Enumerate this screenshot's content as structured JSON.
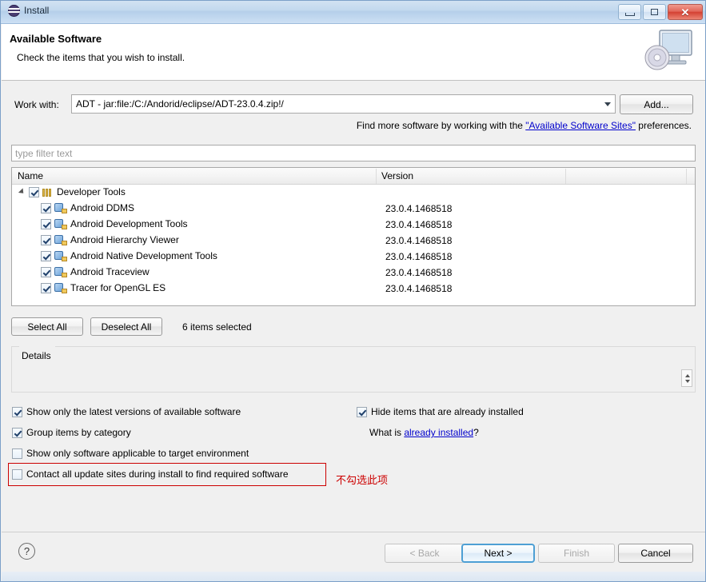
{
  "window": {
    "title": "Install",
    "icon": "eclipse-icon",
    "buttons": {
      "minimize": "minimize-icon",
      "maximize": "maximize-icon",
      "close": "✕"
    }
  },
  "banner": {
    "title": "Available Software",
    "subtitle": "Check the items that you wish to install.",
    "icon": "monitor-disc-icon"
  },
  "work_with": {
    "label": "Work with:",
    "value": "ADT - jar:file:/C:/Andorid/eclipse/ADT-23.0.4.zip!/",
    "add_button": "Add..."
  },
  "find_more": {
    "prefix": "Find more software by working with the ",
    "link": "\"Available Software Sites\"",
    "suffix": " preferences."
  },
  "filter": {
    "placeholder": "type filter text",
    "value": ""
  },
  "table": {
    "columns": [
      "Name",
      "Version",
      ""
    ],
    "rows": [
      {
        "name": "Developer Tools",
        "version": "",
        "checked": true,
        "level": 0,
        "icon": "category-icon",
        "expanded": true
      },
      {
        "name": "Android DDMS",
        "version": "23.0.4.1468518",
        "checked": true,
        "level": 1,
        "icon": "feature-icon"
      },
      {
        "name": "Android Development Tools",
        "version": "23.0.4.1468518",
        "checked": true,
        "level": 1,
        "icon": "feature-icon"
      },
      {
        "name": "Android Hierarchy Viewer",
        "version": "23.0.4.1468518",
        "checked": true,
        "level": 1,
        "icon": "feature-icon"
      },
      {
        "name": "Android Native Development Tools",
        "version": "23.0.4.1468518",
        "checked": true,
        "level": 1,
        "icon": "feature-icon"
      },
      {
        "name": "Android Traceview",
        "version": "23.0.4.1468518",
        "checked": true,
        "level": 1,
        "icon": "feature-icon"
      },
      {
        "name": "Tracer for OpenGL ES",
        "version": "23.0.4.1468518",
        "checked": true,
        "level": 1,
        "icon": "feature-icon"
      }
    ]
  },
  "actions": {
    "select_all": "Select All",
    "deselect_all": "Deselect All",
    "status": "6 items selected"
  },
  "details": {
    "label": "Details",
    "content": ""
  },
  "options": {
    "latest_versions": {
      "label": "Show only the latest versions of available software",
      "checked": true
    },
    "group_by_category": {
      "label": "Group items by category",
      "checked": true
    },
    "target_environment": {
      "label": "Show only software applicable to target environment",
      "checked": false
    },
    "contact_update_sites": {
      "label": "Contact all update sites during install to find required software",
      "checked": false
    },
    "hide_installed": {
      "label": "Hide items that are already installed",
      "checked": true
    },
    "what_is": {
      "prefix": "What is ",
      "link": "already installed",
      "suffix": "?"
    }
  },
  "annotation": {
    "text": "不勾选此项",
    "color": "#cc0000"
  },
  "footer": {
    "help": "?",
    "back": "< Back",
    "next": "Next >",
    "finish": "Finish",
    "cancel": "Cancel"
  }
}
